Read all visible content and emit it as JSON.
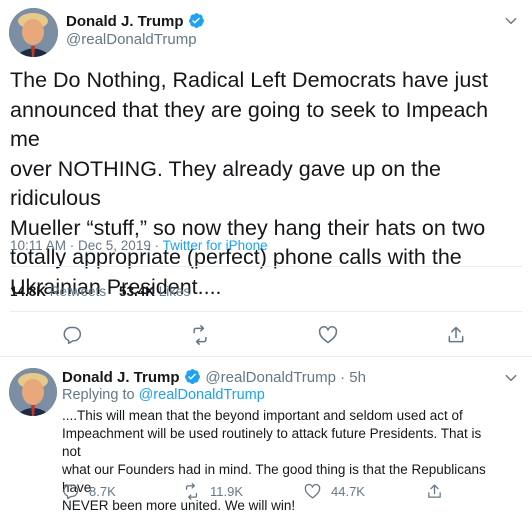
{
  "main_tweet": {
    "author_name": "Donald J. Trump",
    "author_handle": "@realDonaldTrump",
    "text": "The Do Nothing, Radical Left Democrats have just\nannounced that they are going to seek to Impeach me\nover NOTHING. They already gave up on the ridiculous\nMueller “stuff,” so now they hang their hats on two\ntotally appropriate (perfect) phone calls with the\nUkrainian President....",
    "time": "10:11 AM · Dec 5, 2019 · ",
    "source": "Twitter for iPhone",
    "retweets_count": "14.8K",
    "retweets_label": "Retweets",
    "likes_count": "53.4K",
    "likes_label": "Likes"
  },
  "reply_tweet": {
    "author_name": "Donald J. Trump",
    "author_handle": "@realDonaldTrump · 5h",
    "replying_prefix": "Replying to ",
    "replying_to": "@realDonaldTrump",
    "text": "....This will mean that the beyond important and seldom used act of\nImpeachment will be used routinely to attack future Presidents. That is not\nwhat our Founders had in mind. The good thing is that the Republicans have\nNEVER been more united. We will win!",
    "reply_count": "8.7K",
    "retweet_count": "11.9K",
    "like_count": "44.7K"
  },
  "colors": {
    "accent": "#1da1f2",
    "secondary_text": "#657786",
    "divider": "#e6ecf0"
  },
  "icons": [
    "verified-badge-icon",
    "chevron-down-icon",
    "reply-icon",
    "retweet-icon",
    "like-icon",
    "share-icon"
  ]
}
